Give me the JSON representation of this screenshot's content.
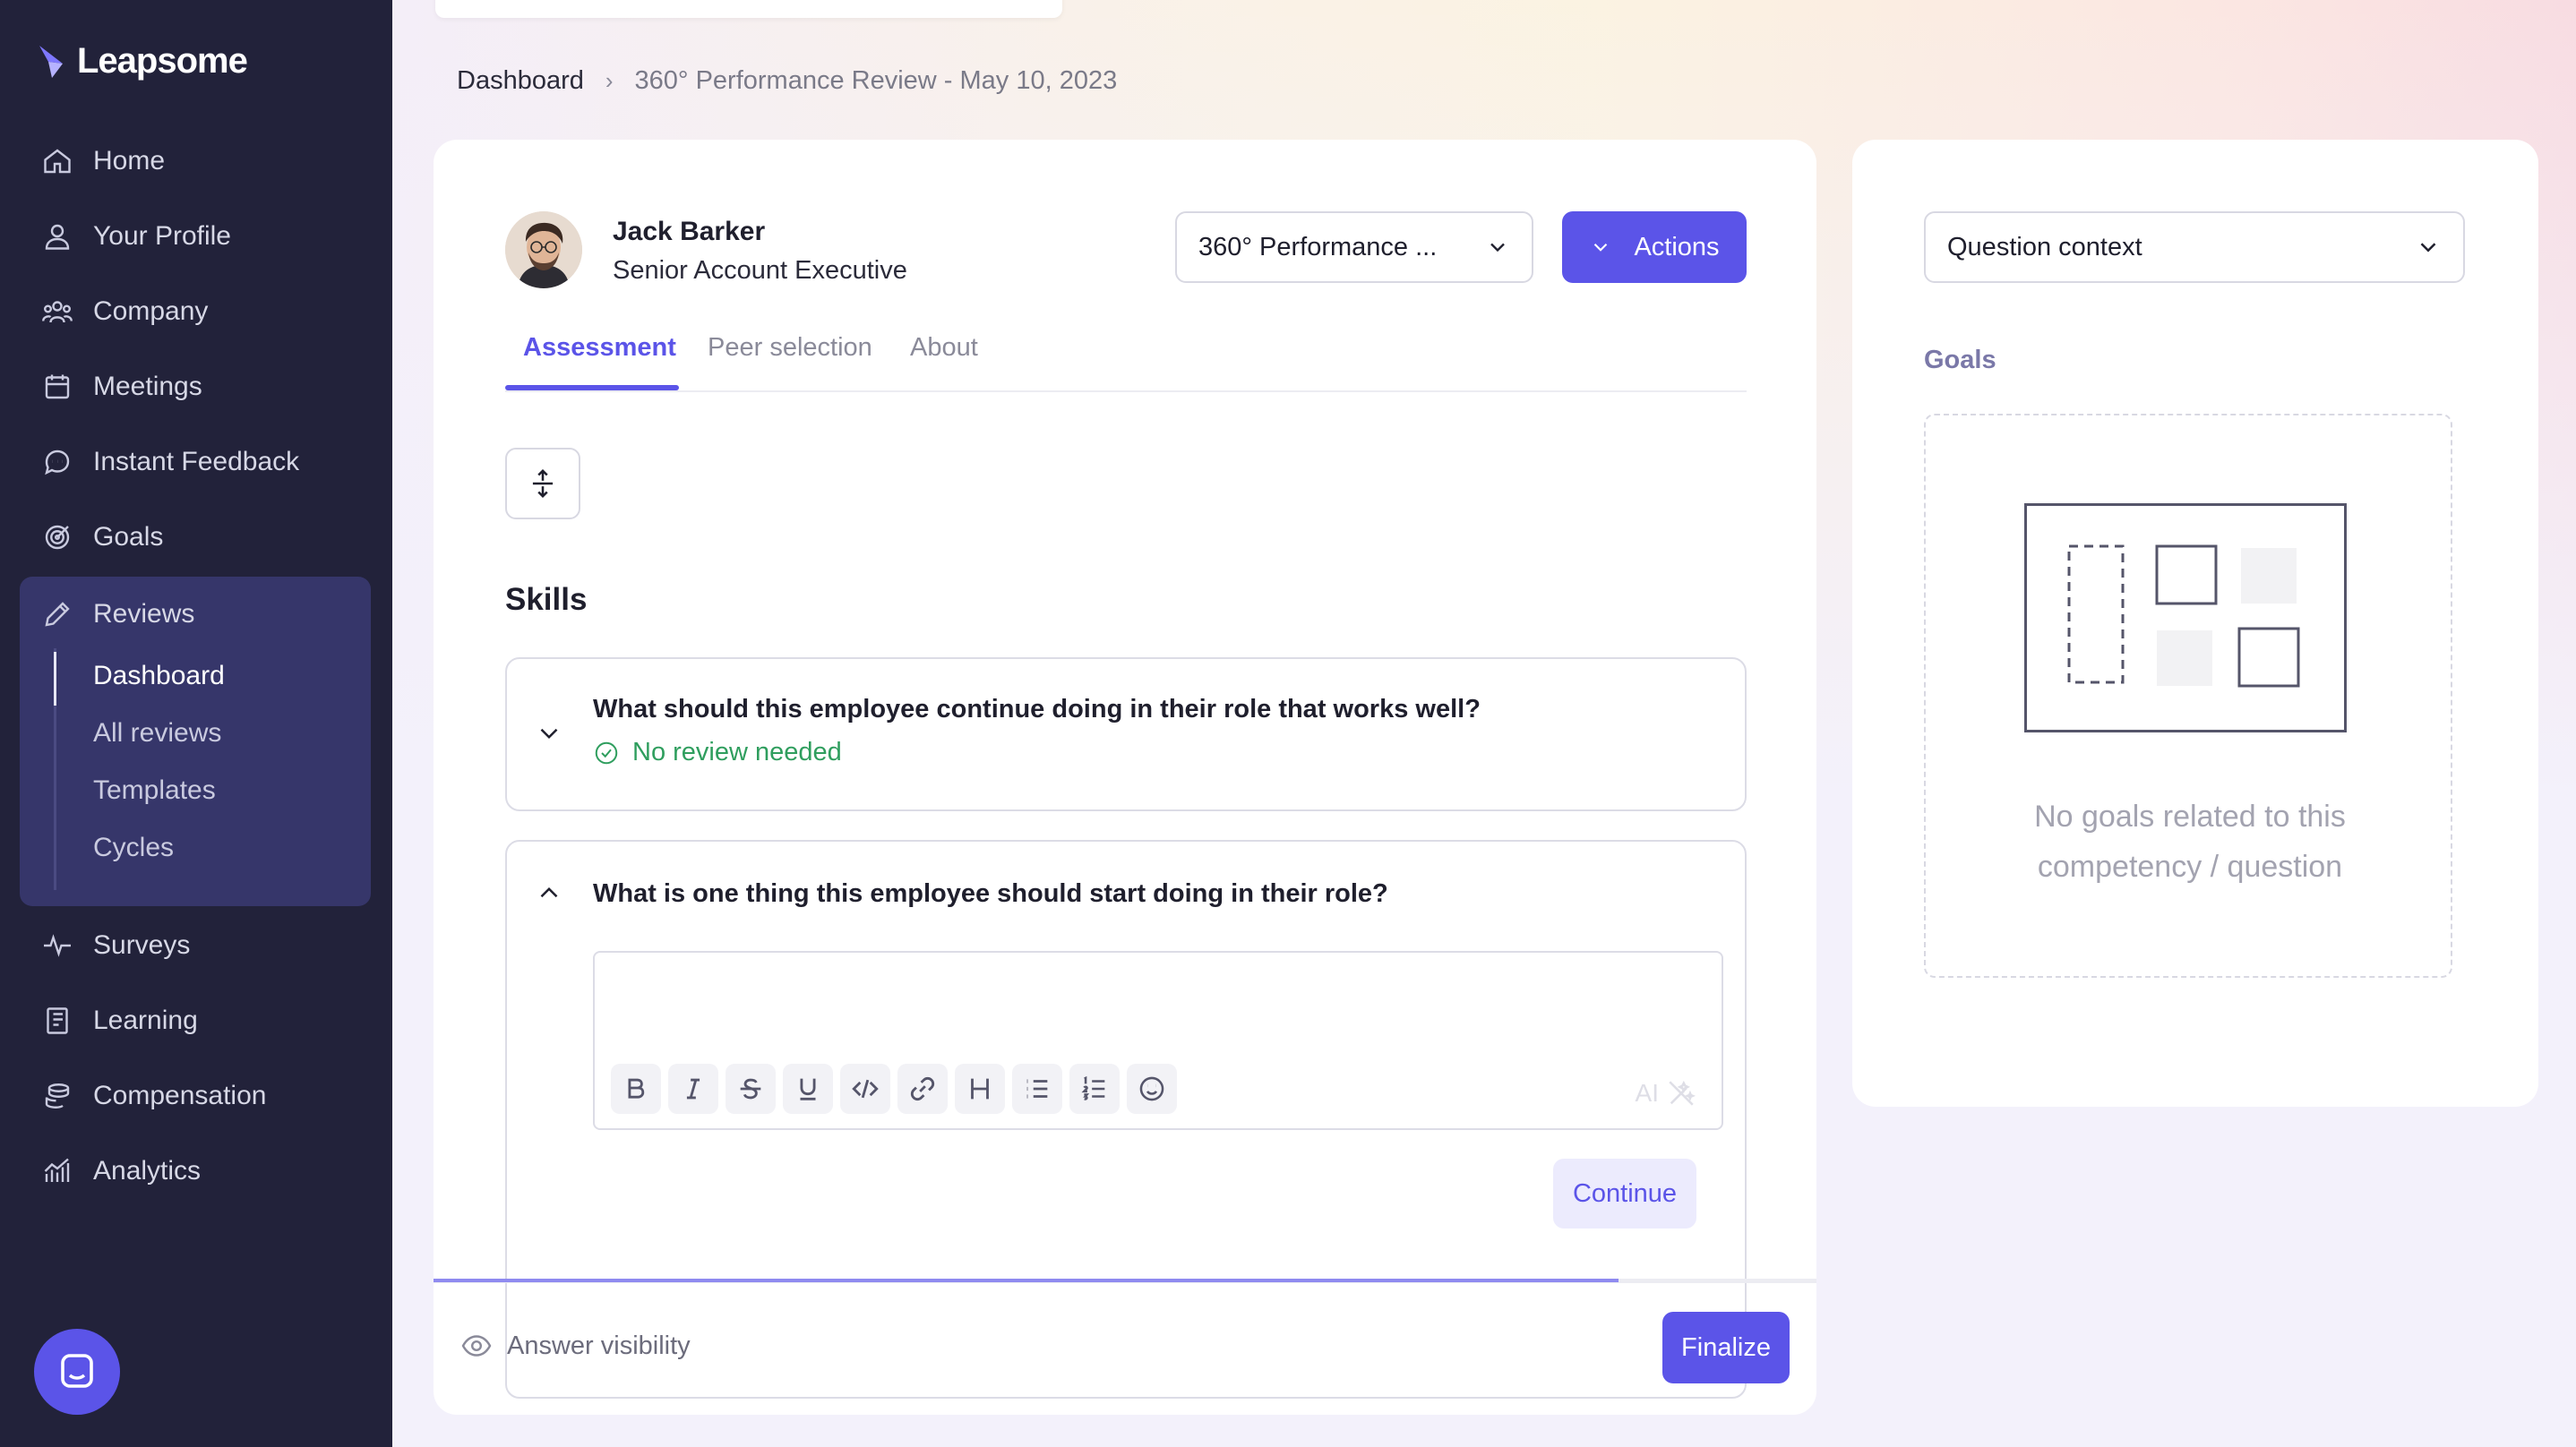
{
  "app": {
    "name": "Leapsome"
  },
  "sidebar": {
    "items": [
      {
        "label": "Home",
        "icon": "home-icon"
      },
      {
        "label": "Your Profile",
        "icon": "user-icon"
      },
      {
        "label": "Company",
        "icon": "users-icon"
      },
      {
        "label": "Meetings",
        "icon": "calendar-icon"
      },
      {
        "label": "Instant Feedback",
        "icon": "chat-icon"
      },
      {
        "label": "Goals",
        "icon": "target-icon"
      },
      {
        "label": "Reviews",
        "icon": "pencil-icon"
      },
      {
        "label": "Surveys",
        "icon": "pulse-icon"
      },
      {
        "label": "Learning",
        "icon": "book-icon"
      },
      {
        "label": "Compensation",
        "icon": "coins-icon"
      },
      {
        "label": "Analytics",
        "icon": "chart-icon"
      }
    ],
    "reviews_sub": [
      "Dashboard",
      "All reviews",
      "Templates",
      "Cycles"
    ],
    "active_sub": "Dashboard"
  },
  "breadcrumb": {
    "root": "Dashboard",
    "current": "360° Performance Review - May 10, 2023"
  },
  "employee": {
    "name": "Jack Barker",
    "role": "Senior Account Executive"
  },
  "review_select": {
    "value": "360° Performance ..."
  },
  "actions_label": "Actions",
  "tabs": [
    "Assessment",
    "Peer selection",
    "About"
  ],
  "active_tab": "Assessment",
  "section": {
    "title": "Skills"
  },
  "questions": [
    {
      "text": "What should this employee continue doing in their role that works well?",
      "status": "No review needed",
      "expanded": false
    },
    {
      "text": "What is one thing this employee should start doing in their role?",
      "expanded": true
    }
  ],
  "editor": {
    "ai_label": "AI"
  },
  "continue_label": "Continue",
  "progress": 0.857,
  "footer": {
    "visibility_label": "Answer visibility",
    "finalize_label": "Finalize"
  },
  "right_panel": {
    "context_select": "Question context",
    "goals_label": "Goals",
    "empty_line1": "No goals related to this",
    "empty_line2": "competency / question"
  },
  "colors": {
    "accent": "#5b54e8",
    "sidebar_bg": "#22223a",
    "success": "#2f9e5e"
  }
}
